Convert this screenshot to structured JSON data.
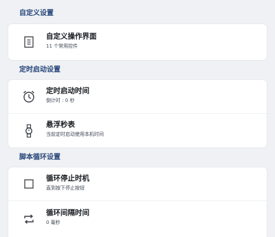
{
  "sections": [
    {
      "header": "自定义设置",
      "items": [
        {
          "title": "自定义操作界面",
          "subtitle": "11 个常用控件",
          "icon": "list-panel-icon"
        }
      ]
    },
    {
      "header": "定时启动设置",
      "items": [
        {
          "title": "定时启动时间",
          "subtitle": "倒计时 : 0 秒",
          "icon": "alarm-clock-icon"
        },
        {
          "title": "悬浮秒表",
          "subtitle": "当前定时启动使用本机时间",
          "icon": "watch-icon"
        }
      ]
    },
    {
      "header": "脚本循环设置",
      "items": [
        {
          "title": "循环停止时机",
          "subtitle": "直到按下停止按钮",
          "icon": "square-icon"
        },
        {
          "title": "循环间隔时间",
          "subtitle": "0 毫秒",
          "icon": "repeat-icon"
        }
      ]
    }
  ],
  "colors": {
    "background": "#eff1f4",
    "section_header": "#27467a",
    "card": "#ffffff"
  }
}
